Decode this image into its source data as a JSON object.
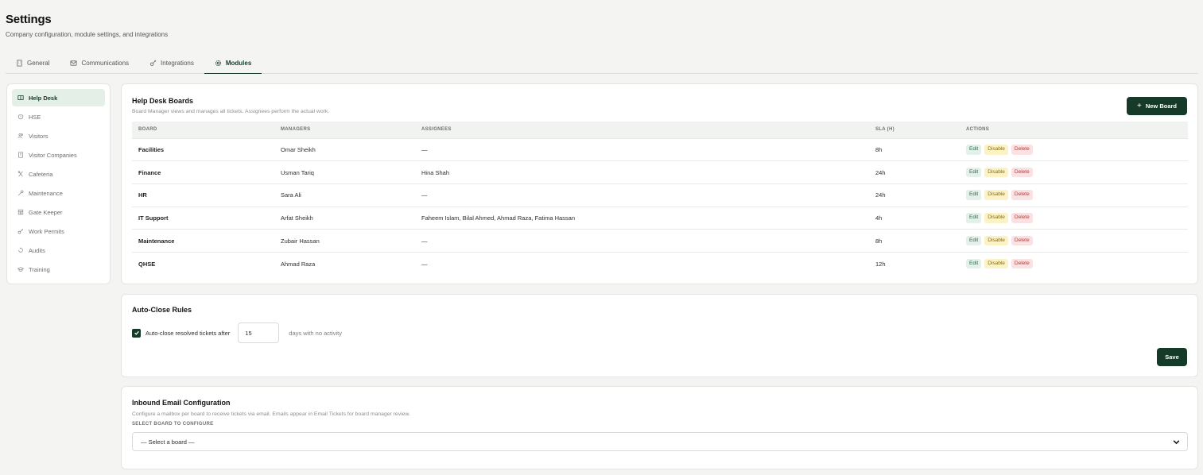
{
  "page": {
    "title": "Settings",
    "subtitle": "Company configuration, module settings, and integrations"
  },
  "tabs": [
    {
      "label": "General",
      "icon": "building-icon",
      "active": false
    },
    {
      "label": "Communications",
      "icon": "mail-icon",
      "active": false
    },
    {
      "label": "Integrations",
      "icon": "link-icon",
      "active": false
    },
    {
      "label": "Modules",
      "icon": "gear-icon",
      "active": true
    }
  ],
  "sidebar": {
    "items": [
      {
        "label": "Help Desk",
        "icon": "board-icon",
        "active": true
      },
      {
        "label": "HSE",
        "icon": "shield-icon",
        "active": false
      },
      {
        "label": "Visitors",
        "icon": "users-icon",
        "active": false
      },
      {
        "label": "Visitor Companies",
        "icon": "building-icon",
        "active": false
      },
      {
        "label": "Cafeteria",
        "icon": "utensils-icon",
        "active": false
      },
      {
        "label": "Maintenance",
        "icon": "wrench-icon",
        "active": false
      },
      {
        "label": "Gate Keeper",
        "icon": "gate-icon",
        "active": false
      },
      {
        "label": "Work Permits",
        "icon": "key-icon",
        "active": false
      },
      {
        "label": "Audits",
        "icon": "clipboard-icon",
        "active": false
      },
      {
        "label": "Training",
        "icon": "graduation-icon",
        "active": false
      }
    ]
  },
  "boards": {
    "title": "Help Desk Boards",
    "description": "Board Manager views and manages all tickets. Assignees perform the actual work.",
    "new_button": "New Board",
    "columns": [
      "BOARD",
      "MANAGERS",
      "ASSIGNEES",
      "SLA (H)",
      "ACTIONS"
    ],
    "actions": {
      "edit": "Edit",
      "disable": "Disable",
      "delete": "Delete"
    },
    "rows": [
      {
        "board": "Facilities",
        "managers": "Omar Sheikh",
        "assignees": "—",
        "sla": "8h"
      },
      {
        "board": "Finance",
        "managers": "Usman Tariq",
        "assignees": "Hina Shah",
        "sla": "24h"
      },
      {
        "board": "HR",
        "managers": "Sara Ali",
        "assignees": "—",
        "sla": "24h"
      },
      {
        "board": "IT Support",
        "managers": "Arfat Sheikh",
        "assignees": "Faheem Islam, Bilal Ahmed, Ahmad Raza, Fatima Hassan",
        "sla": "4h"
      },
      {
        "board": "Maintenance",
        "managers": "Zubair Hassan",
        "assignees": "—",
        "sla": "8h"
      },
      {
        "board": "QHSE",
        "managers": "Ahmad Raza",
        "assignees": "—",
        "sla": "12h"
      }
    ]
  },
  "auto_close": {
    "title": "Auto-Close Rules",
    "checkbox_label": "Auto-close resolved tickets after",
    "checked": true,
    "days_value": "15",
    "suffix": "days with no activity",
    "save_label": "Save"
  },
  "inbound_email": {
    "title": "Inbound Email Configuration",
    "description": "Configure a mailbox per board to receive tickets via email. Emails appear in Email Tickets for board manager review.",
    "field_label": "SELECT BOARD TO CONFIGURE",
    "select_value": "— Select a board —"
  },
  "colors": {
    "accent": "#163a28",
    "active_bg": "#e4efe8",
    "edit_bg": "#e4f1ea",
    "disable_bg": "#fbf2c6",
    "delete_bg": "#fbe2e2"
  }
}
